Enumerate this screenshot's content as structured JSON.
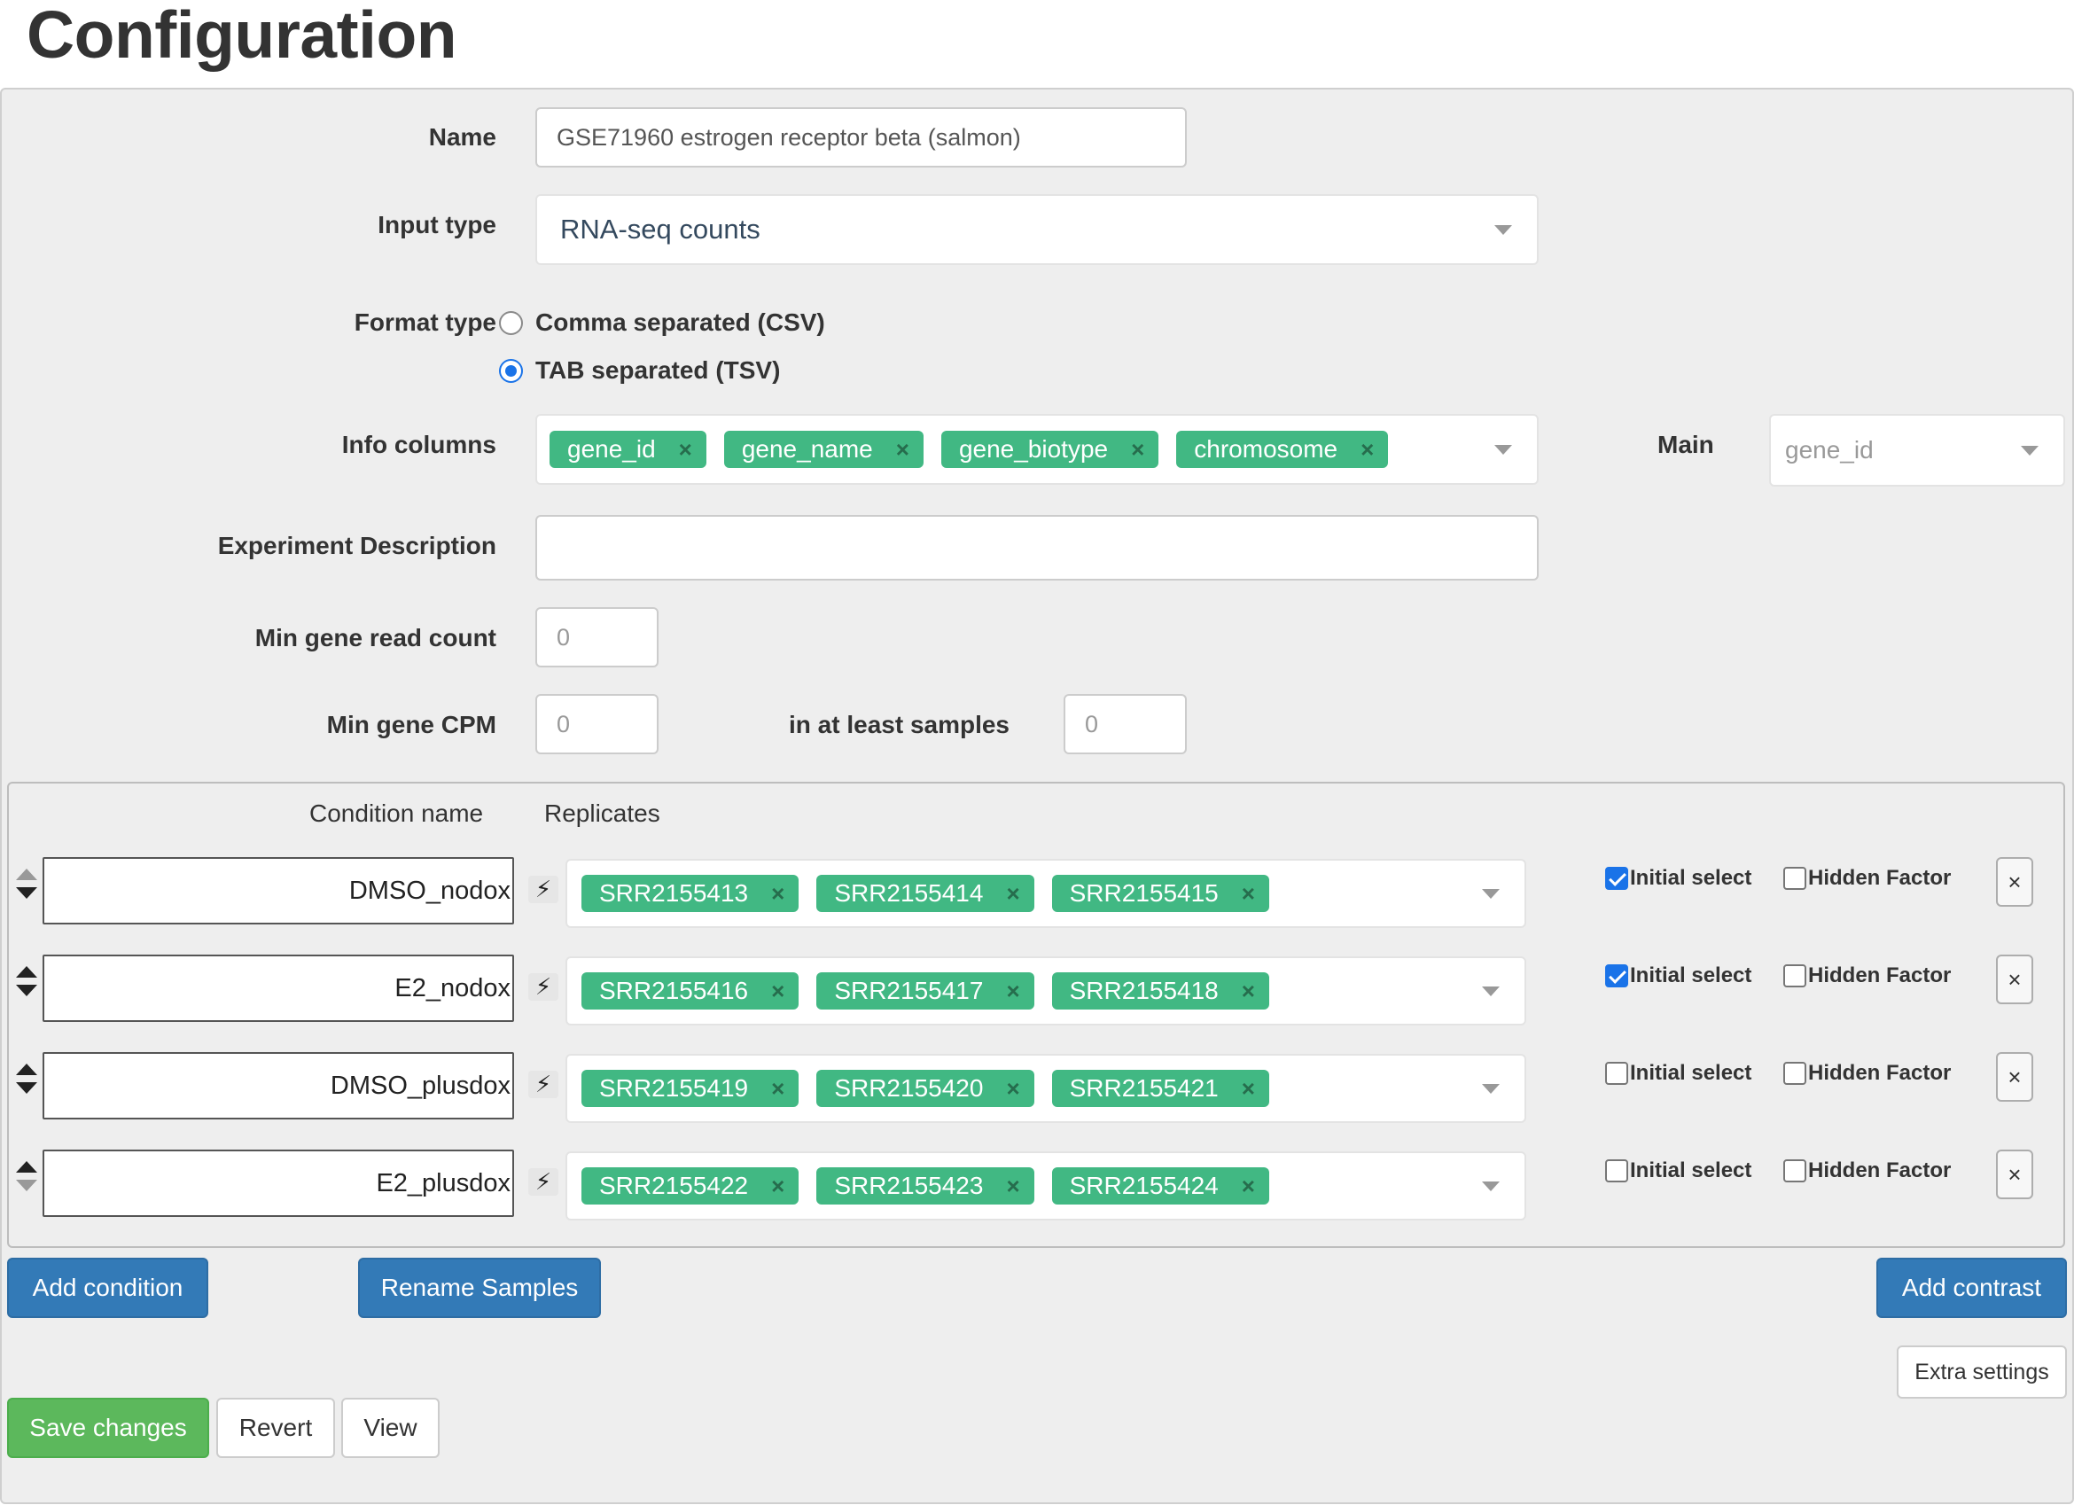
{
  "page": {
    "title": "Configuration"
  },
  "form": {
    "name": {
      "label": "Name",
      "value": "GSE71960 estrogen receptor beta (salmon)"
    },
    "input_type": {
      "label": "Input type",
      "value": "RNA-seq counts"
    },
    "format_type": {
      "label": "Format type",
      "options": [
        {
          "label": "Comma separated (CSV)",
          "checked": false
        },
        {
          "label": "TAB separated (TSV)",
          "checked": true
        }
      ]
    },
    "info_columns": {
      "label": "Info columns",
      "tags": [
        "gene_id",
        "gene_name",
        "gene_biotype",
        "chromosome"
      ],
      "remove_glyph": "×"
    },
    "main": {
      "label": "Main",
      "value": "gene_id"
    },
    "experiment_description": {
      "label": "Experiment Description",
      "value": ""
    },
    "min_gene_read_count": {
      "label": "Min gene read count",
      "placeholder": "0"
    },
    "min_gene_cpm": {
      "label": "Min gene CPM",
      "placeholder": "0"
    },
    "in_at_least_samples": {
      "label": "in at least samples",
      "placeholder": "0"
    }
  },
  "conditions": {
    "header_condition": "Condition name",
    "header_replicates": "Replicates",
    "initial_select_label": "Initial select",
    "hidden_factor_label": "Hidden Factor",
    "delete_glyph": "×",
    "bolt_glyph": "⚡",
    "rows": [
      {
        "name": "DMSO_nodox",
        "replicates": [
          "SRR2155413",
          "SRR2155414",
          "SRR2155415"
        ],
        "initial_select": true,
        "hidden_factor": false
      },
      {
        "name": "E2_nodox",
        "replicates": [
          "SRR2155416",
          "SRR2155417",
          "SRR2155418"
        ],
        "initial_select": true,
        "hidden_factor": false
      },
      {
        "name": "DMSO_plusdox",
        "replicates": [
          "SRR2155419",
          "SRR2155420",
          "SRR2155421"
        ],
        "initial_select": false,
        "hidden_factor": false
      },
      {
        "name": "E2_plusdox",
        "replicates": [
          "SRR2155422",
          "SRR2155423",
          "SRR2155424"
        ],
        "initial_select": false,
        "hidden_factor": false
      }
    ]
  },
  "actions": {
    "add_condition": "Add condition",
    "rename_samples": "Rename Samples",
    "add_contrast": "Add contrast",
    "extra_settings": "Extra settings",
    "save_changes": "Save changes",
    "revert": "Revert",
    "view": "View"
  },
  "colors": {
    "tag_bg": "#41b883",
    "primary": "#337ab7",
    "success": "#5cb85c",
    "panel_bg": "#eeeeee"
  }
}
